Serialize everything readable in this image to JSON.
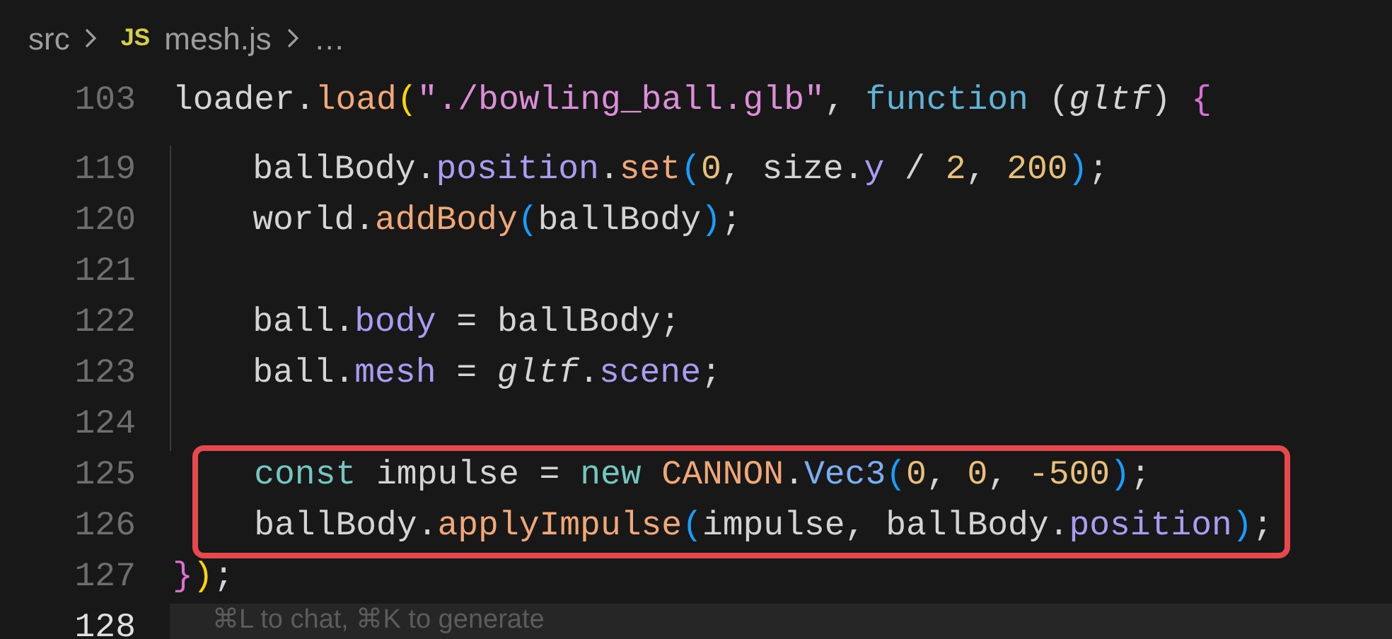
{
  "breadcrumb": {
    "folder": "src",
    "file_icon": "JS",
    "file": "mesh.js",
    "more": "…"
  },
  "sticky_line": {
    "number": "103",
    "tokens": [
      {
        "text": "loader.",
        "kind": "plain"
      },
      {
        "text": "load",
        "kind": "method"
      },
      {
        "text": "(",
        "kind": "bracket1"
      },
      {
        "text": "\"./bowling_ball.glb\"",
        "kind": "string"
      },
      {
        "text": ", ",
        "kind": "plain"
      },
      {
        "text": "function",
        "kind": "storage"
      },
      {
        "text": " (",
        "kind": "plain"
      },
      {
        "text": "gltf",
        "kind": "param"
      },
      {
        "text": ") ",
        "kind": "plain"
      },
      {
        "text": "{",
        "kind": "bracket2"
      }
    ]
  },
  "lines": [
    {
      "number": "119",
      "current": false,
      "highlighted": false,
      "tokens": [
        {
          "text": "    ballBody.",
          "kind": "plain"
        },
        {
          "text": "position",
          "kind": "property"
        },
        {
          "text": ".",
          "kind": "plain"
        },
        {
          "text": "set",
          "kind": "method"
        },
        {
          "text": "(",
          "kind": "bracket3"
        },
        {
          "text": "0",
          "kind": "number"
        },
        {
          "text": ", size.",
          "kind": "plain"
        },
        {
          "text": "y",
          "kind": "property"
        },
        {
          "text": " / ",
          "kind": "plain"
        },
        {
          "text": "2",
          "kind": "number"
        },
        {
          "text": ", ",
          "kind": "plain"
        },
        {
          "text": "200",
          "kind": "number"
        },
        {
          "text": ")",
          "kind": "bracket3"
        },
        {
          "text": ";",
          "kind": "plain"
        }
      ]
    },
    {
      "number": "120",
      "current": false,
      "highlighted": false,
      "tokens": [
        {
          "text": "    world.",
          "kind": "plain"
        },
        {
          "text": "addBody",
          "kind": "method"
        },
        {
          "text": "(",
          "kind": "bracket3"
        },
        {
          "text": "ballBody",
          "kind": "plain"
        },
        {
          "text": ")",
          "kind": "bracket3"
        },
        {
          "text": ";",
          "kind": "plain"
        }
      ]
    },
    {
      "number": "121",
      "current": false,
      "highlighted": false
    },
    {
      "number": "122",
      "current": false,
      "highlighted": false,
      "tokens": [
        {
          "text": "    ball.",
          "kind": "plain"
        },
        {
          "text": "body",
          "kind": "property"
        },
        {
          "text": " = ballBody;",
          "kind": "plain"
        }
      ]
    },
    {
      "number": "123",
      "current": false,
      "highlighted": false,
      "tokens": [
        {
          "text": "    ball.",
          "kind": "plain"
        },
        {
          "text": "mesh",
          "kind": "property"
        },
        {
          "text": " = ",
          "kind": "plain"
        },
        {
          "text": "gltf",
          "kind": "param"
        },
        {
          "text": ".",
          "kind": "plain"
        },
        {
          "text": "scene",
          "kind": "property"
        },
        {
          "text": ";",
          "kind": "plain"
        }
      ]
    },
    {
      "number": "124",
      "current": false,
      "highlighted": false
    },
    {
      "number": "125",
      "current": false,
      "highlighted": true,
      "tokens": [
        {
          "text": "    const",
          "kind": "keyword"
        },
        {
          "text": " impulse = ",
          "kind": "plain"
        },
        {
          "text": "new ",
          "kind": "keyword"
        },
        {
          "text": "CANNON",
          "kind": "class"
        },
        {
          "text": ".",
          "kind": "plain"
        },
        {
          "text": "Vec3",
          "kind": "type"
        },
        {
          "text": "(",
          "kind": "bracket3"
        },
        {
          "text": "0",
          "kind": "number"
        },
        {
          "text": ", ",
          "kind": "plain"
        },
        {
          "text": "0",
          "kind": "number"
        },
        {
          "text": ", ",
          "kind": "plain"
        },
        {
          "text": "-500",
          "kind": "number"
        },
        {
          "text": ")",
          "kind": "bracket3"
        },
        {
          "text": ";",
          "kind": "plain"
        }
      ]
    },
    {
      "number": "126",
      "current": false,
      "highlighted": true,
      "tokens": [
        {
          "text": "    ballBody.",
          "kind": "plain"
        },
        {
          "text": "applyImpulse",
          "kind": "method"
        },
        {
          "text": "(",
          "kind": "bracket3"
        },
        {
          "text": "impulse, ballBody.",
          "kind": "plain"
        },
        {
          "text": "position",
          "kind": "property"
        },
        {
          "text": ")",
          "kind": "bracket3"
        },
        {
          "text": ";",
          "kind": "plain"
        }
      ]
    },
    {
      "number": "127",
      "current": false,
      "highlighted": false,
      "tokens": [
        {
          "text": "}",
          "kind": "bracket2"
        },
        {
          "text": ")",
          "kind": "bracket1"
        },
        {
          "text": ";",
          "kind": "plain"
        }
      ]
    },
    {
      "number": "128",
      "current": true,
      "highlighted": false,
      "hint": "⌘L to chat, ⌘K to generate"
    }
  ]
}
